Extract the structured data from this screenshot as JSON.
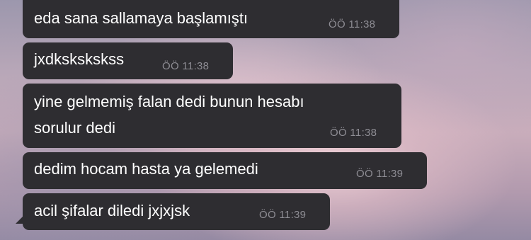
{
  "messages": [
    {
      "text": "eda sana sallamaya başlamıştı",
      "time": "ÖÖ 11:38"
    },
    {
      "text": "jxdkskskskss",
      "time": "ÖÖ 11:38"
    },
    {
      "text_lines": [
        "yine gelmemiş falan dedi bunun hesabı",
        "sorulur dedi"
      ],
      "time": "ÖÖ 11:38"
    },
    {
      "text": "dedim hocam hasta ya gelemedi",
      "time": "ÖÖ 11:39"
    },
    {
      "text": "acil şifalar diledi jxjxjsk",
      "time": "ÖÖ 11:39"
    }
  ]
}
